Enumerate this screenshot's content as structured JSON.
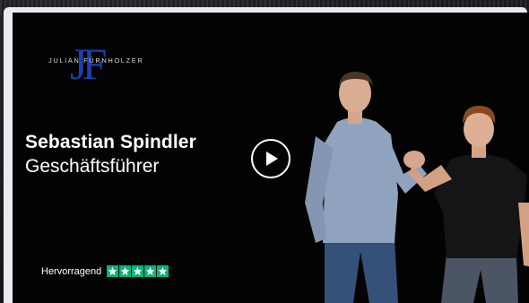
{
  "logo": {
    "mark": "JF",
    "text": "JULIAN FÜRNHOLZER"
  },
  "video": {
    "name": "Sebastian Spindler",
    "role": "Geschäftsführer",
    "play_icon": "play-icon"
  },
  "rating": {
    "label": "Hervorragend",
    "stars": 5,
    "star_color": "#00b67a"
  },
  "colors": {
    "logo_blue": "#1e3fae",
    "background": "#030303"
  }
}
